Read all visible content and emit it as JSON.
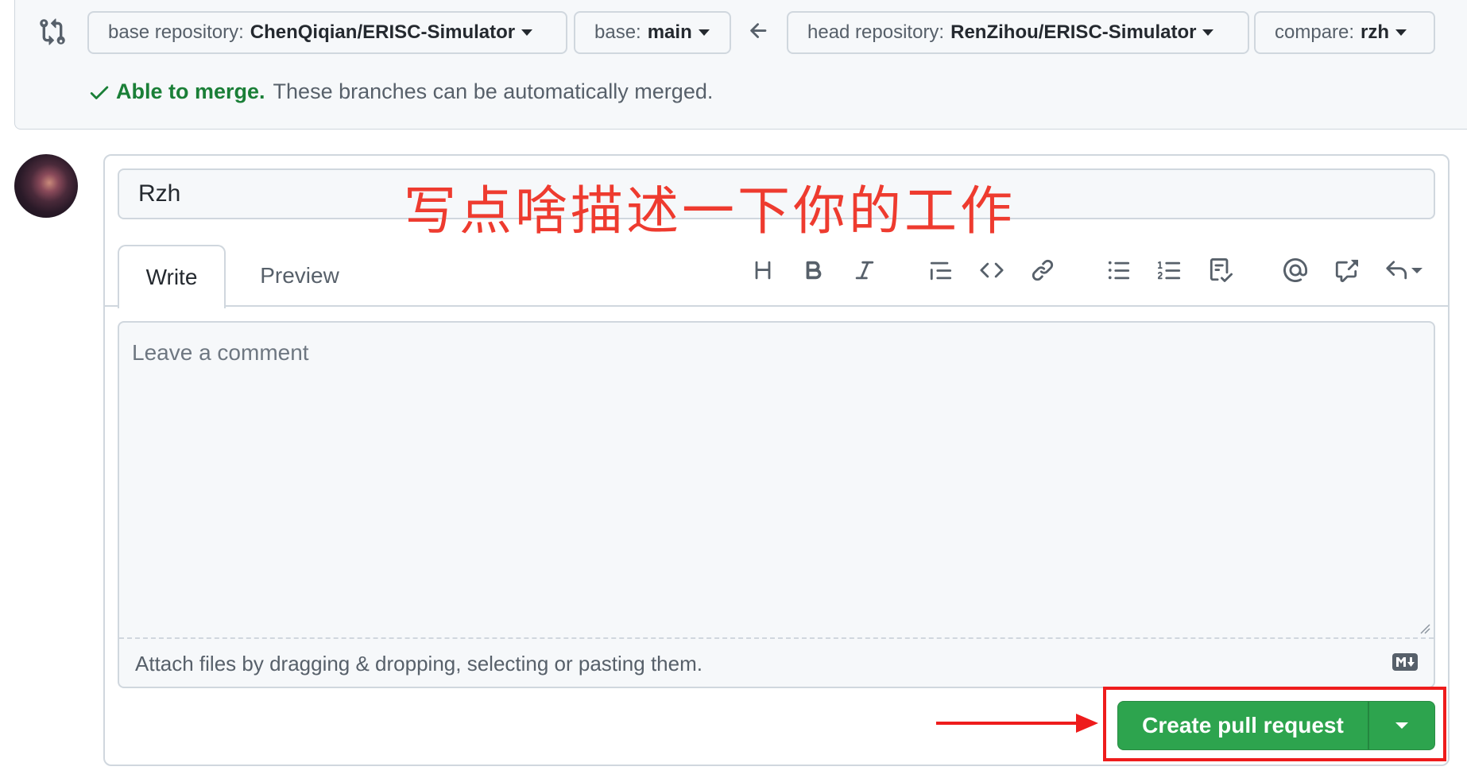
{
  "compare": {
    "base_repo_label": "base repository:",
    "base_repo_value": "ChenQiqian/ERISC-Simulator",
    "base_label": "base:",
    "base_value": "main",
    "head_repo_label": "head repository:",
    "head_repo_value": "RenZihou/ERISC-Simulator",
    "compare_label": "compare:",
    "compare_value": "rzh"
  },
  "merge_status": {
    "ok_text": "Able to merge.",
    "detail": "These branches can be automatically merged."
  },
  "form": {
    "title_value": "Rzh",
    "annotation": "写点啥描述一下你的工作",
    "tabs": [
      {
        "label": "Write"
      },
      {
        "label": "Preview"
      }
    ],
    "toolbar": [
      "heading-icon",
      "bold-icon",
      "italic-icon",
      "quote-icon",
      "code-icon",
      "link-icon",
      "unordered-list-icon",
      "ordered-list-icon",
      "task-list-icon",
      "mention-icon",
      "cross-reference-icon",
      "reply-icon"
    ],
    "comment_placeholder": "Leave a comment",
    "attach_text": "Attach files by dragging & dropping, selecting or pasting them.",
    "submit_label": "Create pull request"
  },
  "colors": {
    "accent_green": "#2da44e",
    "annotation_red": "#ee3b2f",
    "highlight_red": "#ee1c1c"
  }
}
